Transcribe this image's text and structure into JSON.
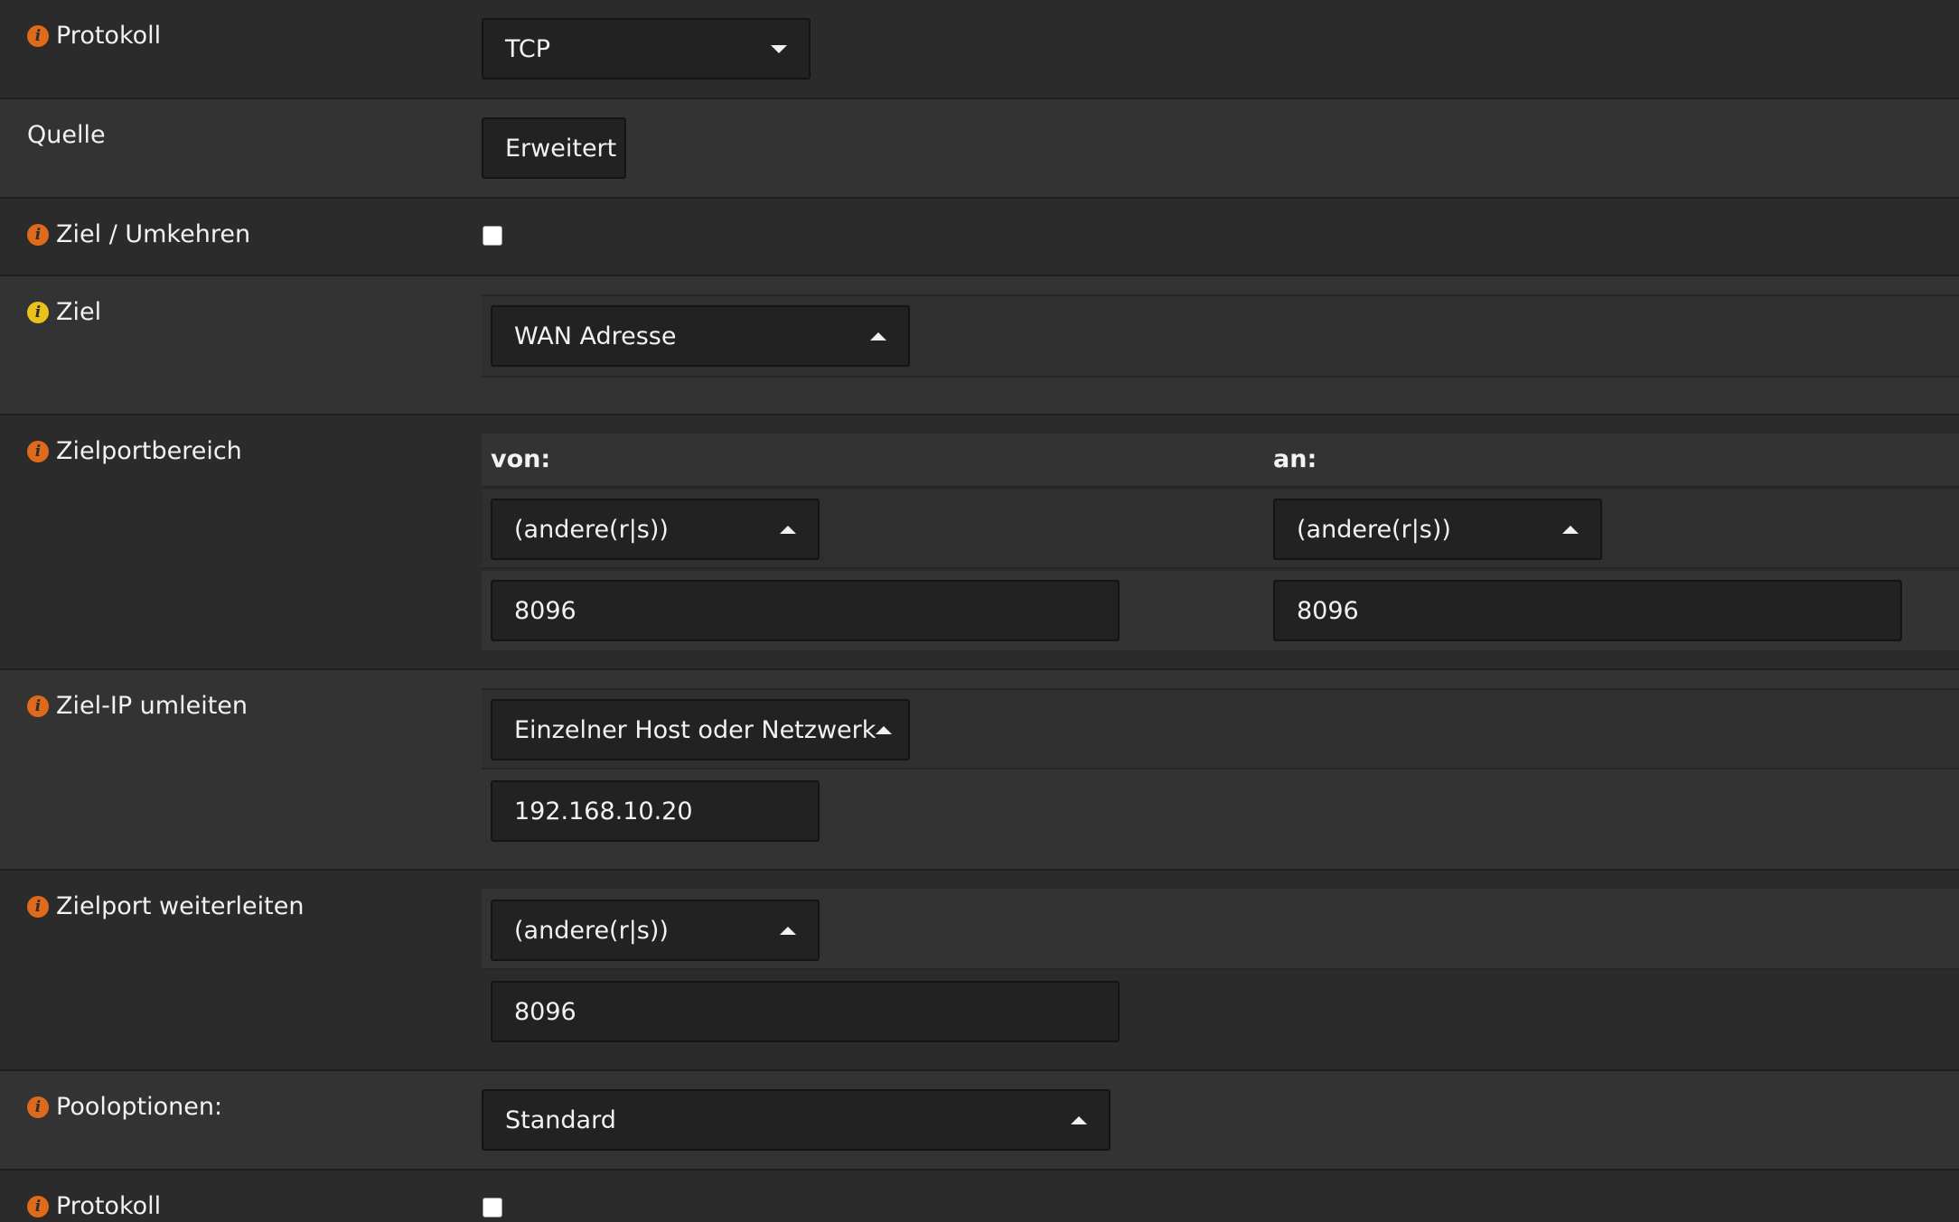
{
  "rows": {
    "protokoll": {
      "label": "Protokoll",
      "select": "TCP"
    },
    "quelle": {
      "label": "Quelle",
      "button": "Erweitert"
    },
    "ziel_umkehren": {
      "label": "Ziel / Umkehren",
      "checked": false
    },
    "ziel": {
      "label": "Ziel",
      "select": "WAN Adresse"
    },
    "zielportbereich": {
      "label": "Zielportbereich",
      "von_label": "von:",
      "an_label": "an:",
      "von_select": "(andere(r|s))",
      "an_select": "(andere(r|s))",
      "von_value": "8096",
      "an_value": "8096"
    },
    "ziel_ip": {
      "label": "Ziel-IP umleiten",
      "select": "Einzelner Host oder Netzwerk",
      "value": "192.168.10.20"
    },
    "zielport": {
      "label": "Zielport weiterleiten",
      "select": "(andere(r|s))",
      "value": "8096"
    },
    "pooloptionen": {
      "label": "Pooloptionen:",
      "select": "Standard"
    },
    "protokoll2": {
      "label": "Protokoll",
      "checked": false
    }
  },
  "colors": {
    "info_icon": "#e06a1b",
    "info_icon_alt": "#e8c21a",
    "background": "#2b2b2b"
  },
  "icons": {
    "info": "info-circle-icon",
    "dropdown": "caret-icon"
  }
}
